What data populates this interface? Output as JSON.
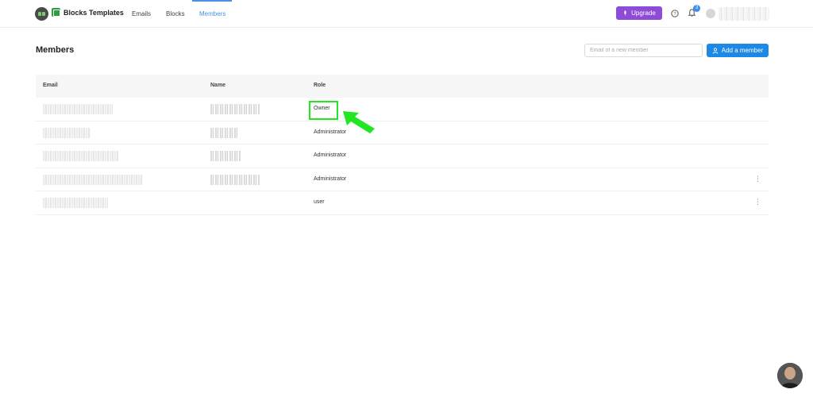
{
  "app": {
    "brand_name": "Blocks Templates"
  },
  "nav": {
    "tabs": [
      {
        "label": "Emails"
      },
      {
        "label": "Blocks"
      },
      {
        "label": "Members"
      }
    ]
  },
  "header_actions": {
    "upgrade_label": "Upgrade",
    "notification_count": "3"
  },
  "page": {
    "title": "Members",
    "email_placeholder": "Email of a new member",
    "add_button_label": "Add a member"
  },
  "table": {
    "columns": [
      "Email",
      "Name",
      "Role"
    ],
    "rows": [
      {
        "role": "Owner"
      },
      {
        "role": "Administrator"
      },
      {
        "role": "Administrator"
      },
      {
        "role": "Administrator"
      },
      {
        "role": "user"
      }
    ]
  },
  "colors": {
    "accent": "#1e88e5",
    "upgrade": "#8e4bd8",
    "highlight": "#22e622"
  }
}
